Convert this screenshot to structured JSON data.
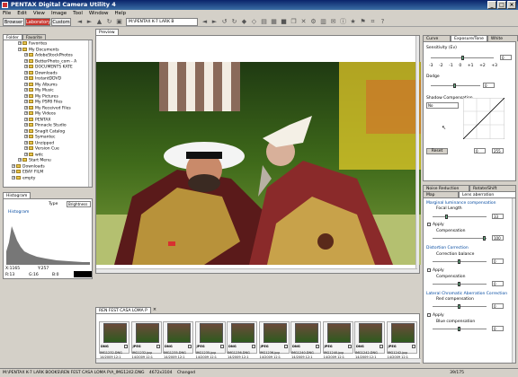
{
  "window": {
    "title": "PENTAX Digital Camera Utility 4",
    "min": "_",
    "max": "□",
    "close": "×"
  },
  "menu": [
    "File",
    "Edit",
    "View",
    "Image",
    "Tool",
    "Window",
    "Help"
  ],
  "toolbar": {
    "browser": "Browser",
    "laboratory": "Laboratory",
    "custom": "Custom",
    "path": "M:\\PENTAX K-7 LARK B"
  },
  "left_tabs": [
    "Folder",
    "Favorite"
  ],
  "tree": [
    {
      "label": "Favorites",
      "indent": 2
    },
    {
      "label": "My Documents",
      "indent": 2
    },
    {
      "label": "AdobeStockPhotos",
      "indent": 3
    },
    {
      "label": "BetterPhoto_com - A",
      "indent": 3
    },
    {
      "label": "DOCUMENTS KATE",
      "indent": 3
    },
    {
      "label": "Downloads",
      "indent": 3
    },
    {
      "label": "InstantDDVD",
      "indent": 3
    },
    {
      "label": "My Albums",
      "indent": 3
    },
    {
      "label": "My Music",
      "indent": 3
    },
    {
      "label": "My Pictures",
      "indent": 3
    },
    {
      "label": "My PSP8 Files",
      "indent": 3
    },
    {
      "label": "My Received Files",
      "indent": 3
    },
    {
      "label": "My Videos",
      "indent": 3
    },
    {
      "label": "PENTAX",
      "indent": 3
    },
    {
      "label": "Pinnacle Studio",
      "indent": 3
    },
    {
      "label": "SnagIt Catalog",
      "indent": 3
    },
    {
      "label": "Symantec",
      "indent": 3
    },
    {
      "label": "Unzipped",
      "indent": 3
    },
    {
      "label": "Version Cue",
      "indent": 3
    },
    {
      "label": "wdc",
      "indent": 3
    },
    {
      "label": "Start Menu",
      "indent": 2
    },
    {
      "label": "Downloads",
      "indent": 1
    },
    {
      "label": "EBAY FILM",
      "indent": 1
    },
    {
      "label": "empty",
      "indent": 1
    }
  ],
  "histogram": {
    "tab": "Histogram",
    "type_label": "Type",
    "type_value": "Brightness",
    "section": "Histogram",
    "x": "X:1165",
    "y": "Y:257",
    "r": "R:13",
    "g": "G:16",
    "b": "B:0"
  },
  "preview": {
    "tab": "Preview"
  },
  "right_top": {
    "tabs": [
      "Curve Image",
      "Exposure/Tone",
      "White Balance"
    ],
    "sensitivity_label": "Sensitivity (Ev)",
    "scale": [
      "-3",
      "-2",
      "-1",
      "0",
      "+1",
      "+2",
      "+3"
    ],
    "sensitivity_value": "0",
    "dodge_label": "Dodge",
    "dodge_value": "0",
    "shadow_label": "Shadow Compensation",
    "shadow_value": "No",
    "reset": "Reset",
    "in_value": "0",
    "out_value": "255"
  },
  "right_bottom": {
    "tabs_row1": [
      "Noise Reduction",
      "Rotate/Shift"
    ],
    "tabs_row2": [
      "Map",
      "Lens aberration correction"
    ],
    "mag_header": "Marginal luminance compensation",
    "focal_label": "Focal Length",
    "focal_value": "33",
    "apply": "Apply",
    "comp_label": "Compensation",
    "comp_value": "100",
    "dist_header": "Distortion Correction",
    "comp_balance_label": "Correction balance",
    "comp_balance_value": "0",
    "dist_comp_value": "0",
    "lca_header": "Lateral Chromatic Aberration Correction",
    "red_label": "Red compensation",
    "red_value": "0",
    "blue_label": "Blue compensation",
    "blue_value": "0"
  },
  "thumbnails": {
    "tab": "REN FEST CASA LOMA P",
    "items": [
      {
        "fmt": "DNG",
        "name": "IMG1232.DNG",
        "date": "14/2009 12:1"
      },
      {
        "fmt": "JPEG",
        "name": "IMG1232.jpg",
        "date": "14/2009 12:1"
      },
      {
        "fmt": "DNG",
        "name": "IMG1235.DNG",
        "date": "14/2009 12:1"
      },
      {
        "fmt": "JPEG",
        "name": "IMG1235.jpg",
        "date": "14/2009 12:1"
      },
      {
        "fmt": "DNG",
        "name": "IMG1236.DNG",
        "date": "14/2009 12:1"
      },
      {
        "fmt": "JPEG",
        "name": "IMG1236.jpg",
        "date": "14/2009 12:1"
      },
      {
        "fmt": "DNG",
        "name": "IMG1240.DNG",
        "date": "14/2009 12:1"
      },
      {
        "fmt": "JPEG",
        "name": "IMG1240.jpg",
        "date": "14/2009 12:1"
      },
      {
        "fmt": "DNG",
        "name": "IMG1242.DNG",
        "date": "14/2009 12:1"
      },
      {
        "fmt": "JPEG",
        "name": "IMG1242.jpg",
        "date": "14/2009 12:1"
      }
    ]
  },
  "status": {
    "path": "M:\\PENTAX K-7 LARK BOOKS\\REN FEST CASA LOMA P\\A_IMG1242.DNG",
    "info": "4672x3104",
    "state": "Changed",
    "count": "39/175"
  }
}
